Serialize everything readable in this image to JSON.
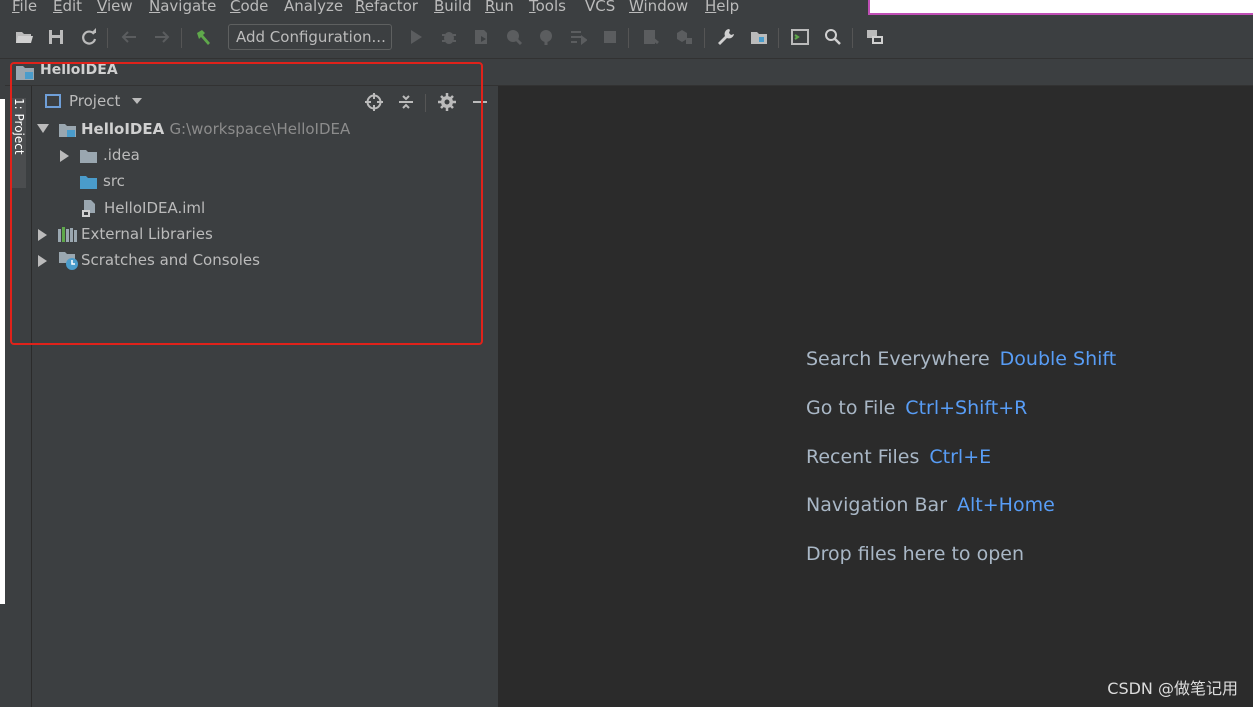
{
  "menu": {
    "items": [
      {
        "u": "F",
        "rest": "ile"
      },
      {
        "u": "E",
        "rest": "dit"
      },
      {
        "u": "V",
        "rest": "iew"
      },
      {
        "u": "N",
        "rest": "avigate"
      },
      {
        "u": "C",
        "rest": "ode"
      },
      {
        "u": "",
        "rest": "Analyze"
      },
      {
        "u": "R",
        "rest": "efactor"
      },
      {
        "u": "B",
        "rest": "uild"
      },
      {
        "u": "R",
        "rest": "un"
      },
      {
        "u": "T",
        "rest": "ools"
      },
      {
        "u": "",
        "rest": "VCS"
      },
      {
        "u": "W",
        "rest": "indow"
      },
      {
        "u": "H",
        "rest": "elp"
      }
    ]
  },
  "toolbar": {
    "add_configuration": "Add Configuration...",
    "icons": [
      "open-folder-icon",
      "save-icon",
      "sync-icon",
      "back-arrow-icon",
      "forward-arrow-icon",
      "build-hammer-icon",
      "run-icon",
      "debug-icon",
      "coverage-icon",
      "profile-icon",
      "attach-icon",
      "step-icon",
      "stop-icon",
      "update-running-icon",
      "build-artifacts-icon",
      "settings-wrench-icon",
      "project-structure-icon",
      "terminal-icon",
      "search-icon",
      "sdk-icon"
    ]
  },
  "navbar": {
    "project_name": "HelloIDEA"
  },
  "stripe": {
    "project_tab": "1: Project"
  },
  "project_panel": {
    "title": "Project",
    "tree": [
      {
        "name": "HelloIDEA",
        "path": "G:\\workspace\\HelloIDEA",
        "expanded": true,
        "bold": true
      },
      {
        "name": ".idea",
        "expanded": false
      },
      {
        "name": "src"
      },
      {
        "name": "HelloIDEA.iml"
      },
      {
        "name": "External Libraries",
        "expanded": false
      },
      {
        "name": "Scratches and Consoles",
        "expanded": false
      }
    ]
  },
  "editor": {
    "hints": [
      {
        "label": "Search Everywhere",
        "key": "Double Shift"
      },
      {
        "label": "Go to File",
        "key": "Ctrl+Shift+R"
      },
      {
        "label": "Recent Files",
        "key": "Ctrl+E"
      },
      {
        "label": "Navigation Bar",
        "key": "Alt+Home"
      },
      {
        "label": "Drop files here to open",
        "key": ""
      }
    ]
  },
  "watermark": "CSDN @做笔记用",
  "colors": {
    "background": "#3c3f41",
    "editor_bg": "#2b2b2b",
    "shortcut_blue": "#589df6",
    "highlight_red": "#e0221a",
    "folder_blue": "#4a9ccb"
  }
}
